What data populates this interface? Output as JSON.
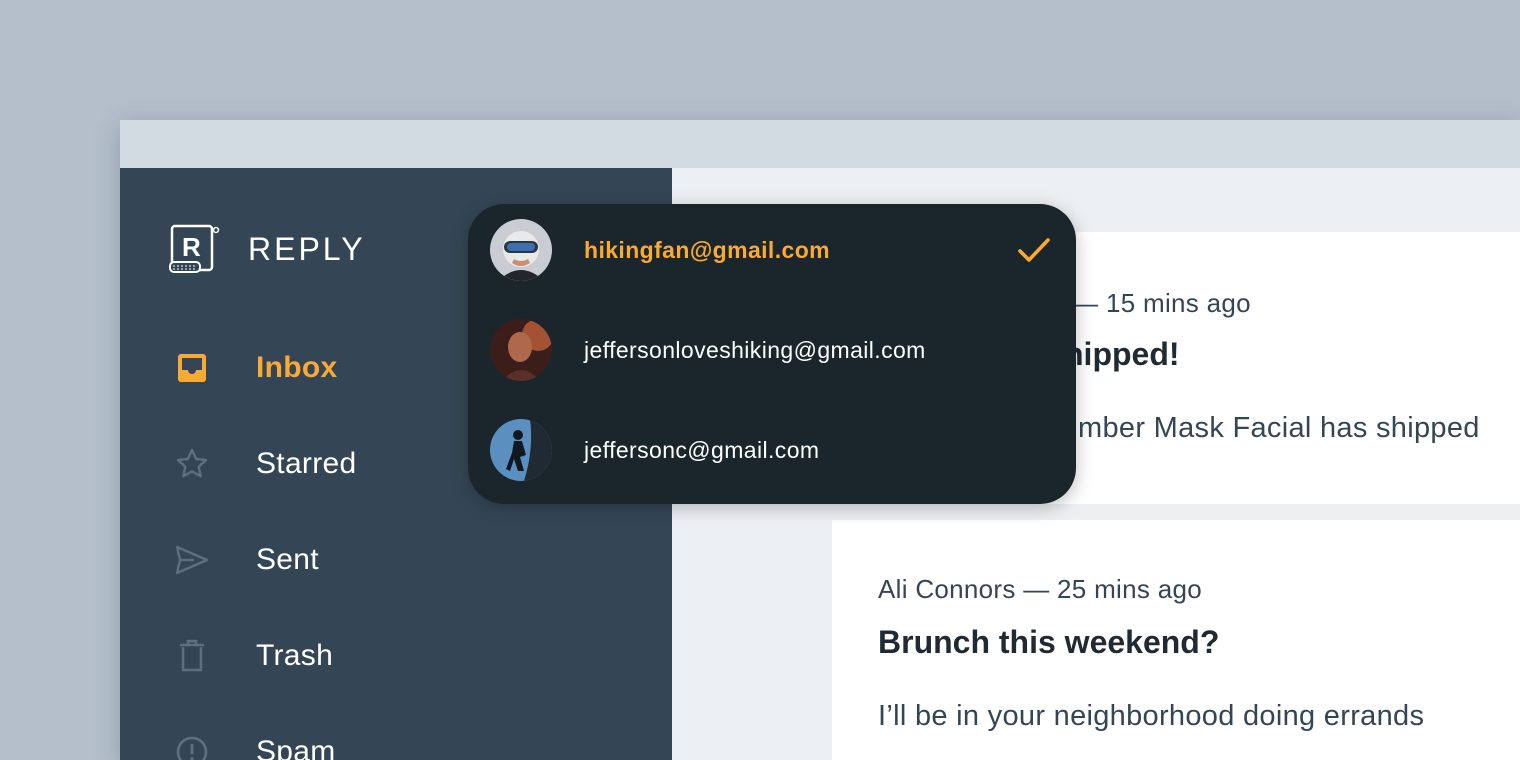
{
  "app": {
    "name": "REPLY"
  },
  "colors": {
    "accent": "#f9aa33",
    "sidebar": "#344655",
    "dropdown": "#1b262c"
  },
  "nav": {
    "items": [
      {
        "label": "Inbox",
        "icon": "inbox-icon",
        "active": true
      },
      {
        "label": "Starred",
        "icon": "star-icon"
      },
      {
        "label": "Sent",
        "icon": "send-icon"
      },
      {
        "label": "Trash",
        "icon": "trash-icon"
      },
      {
        "label": "Spam",
        "icon": "spam-icon"
      }
    ]
  },
  "accounts": {
    "items": [
      {
        "email": "hikingfan@gmail.com",
        "selected": true
      },
      {
        "email": "jeffersonloveshiking@gmail.com"
      },
      {
        "email": "jeffersonc@gmail.com"
      }
    ]
  },
  "emails": [
    {
      "meta": "ss — 15 mins ago",
      "subject": "hipped!",
      "preview": "mber Mask Facial has shipped"
    },
    {
      "meta": "Ali Connors — 25 mins ago",
      "subject": "Brunch this weekend?",
      "preview": "I’ll be in your neighborhood doing errands"
    }
  ]
}
